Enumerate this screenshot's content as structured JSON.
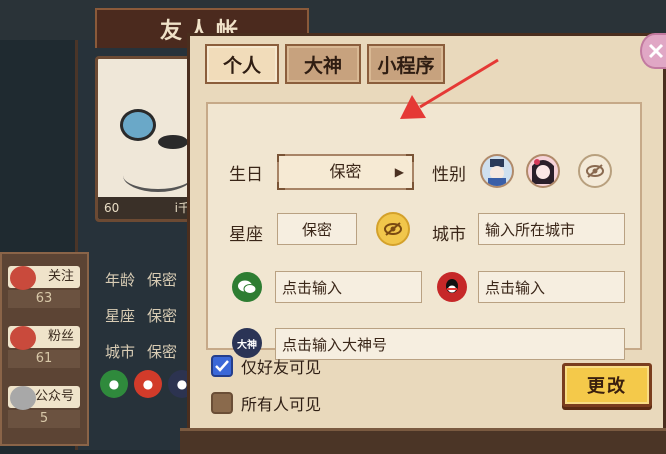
{
  "background": {
    "banner_title": "友人帐",
    "card_left": "60",
    "card_right": "i千秋",
    "info_rows": [
      {
        "label": "年龄",
        "value": "保密"
      },
      {
        "label": "星座",
        "value": "保密"
      },
      {
        "label": "城市",
        "value": "保密"
      }
    ],
    "stats": [
      {
        "label": "关注",
        "count": "63"
      },
      {
        "label": "粉丝",
        "count": "61"
      },
      {
        "label": "公众号",
        "count": "5"
      }
    ]
  },
  "tabs": [
    {
      "label": "个人",
      "active": true
    },
    {
      "label": "大神",
      "active": false
    },
    {
      "label": "小程序",
      "active": false
    }
  ],
  "form": {
    "birthday": {
      "label": "生日",
      "value": "保密"
    },
    "gender": {
      "label": "性别"
    },
    "constellation": {
      "label": "星座",
      "value": "保密"
    },
    "city": {
      "label": "城市",
      "placeholder": "输入所在城市"
    },
    "wechat": {
      "placeholder": "点击输入"
    },
    "qq": {
      "placeholder": "点击输入"
    },
    "dashen": {
      "icon_text": "大神",
      "placeholder": "点击输入大神号"
    }
  },
  "visibility": {
    "friends_only": {
      "label": "仅好友可见",
      "checked": true
    },
    "everyone": {
      "label": "所有人可见",
      "checked": false
    }
  },
  "confirm_label": "更改",
  "colors": {
    "accent_blue": "#3b68d8",
    "button_gold": "#f4c94a",
    "annotation_red": "#e53935"
  }
}
